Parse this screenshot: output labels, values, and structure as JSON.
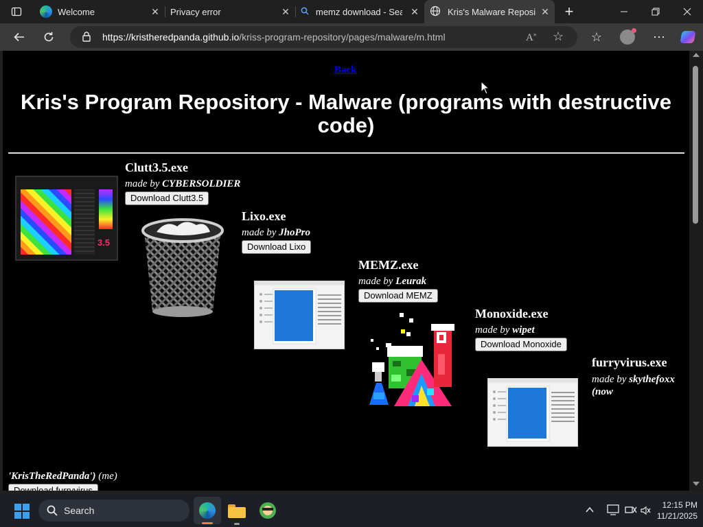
{
  "browser": {
    "tabs": [
      {
        "title": "Welcome",
        "icon": "edge-icon"
      },
      {
        "title": "Privacy error",
        "icon": ""
      },
      {
        "title": "memz download - Search",
        "icon": "search-icon"
      },
      {
        "title": "Kris's Malware Repository",
        "icon": "globe-icon",
        "active": true
      }
    ],
    "url_host": "https://kristheredpanda.github.io",
    "url_path": "/kriss-program-repository/pages/malware/m.html"
  },
  "page": {
    "back_link": "Back",
    "title": "Kris's Program Repository - Malware (programs with destructive code)",
    "programs": [
      {
        "name": "Clutt3.5.exe",
        "made_by": "made by",
        "author": "CYBERSOLDIER",
        "button": "Download Clutt3.5"
      },
      {
        "name": "Lixo.exe",
        "made_by": "made by",
        "author": "JhoPro",
        "button": "Download Lixo"
      },
      {
        "name": "MEMZ.exe",
        "made_by": "made by",
        "author": "Leurak",
        "button": "Download MEMZ"
      },
      {
        "name": "Monoxide.exe",
        "made_by": "made by",
        "author": "wipet",
        "button": "Download Monoxide"
      },
      {
        "name": "furryvirus.exe",
        "made_by": "made by",
        "author": "skythefoxx (now",
        "author_cont": "'KrisTheRedPanda')",
        "author_note": "(me)",
        "button": "Download furryvirus"
      }
    ]
  },
  "taskbar": {
    "search_placeholder": "Search",
    "time": "12:15 PM",
    "date": "11/21/2025"
  },
  "colors": {
    "page_bg": "#000000",
    "link": "#0000ee",
    "accent": "#0078d4"
  }
}
